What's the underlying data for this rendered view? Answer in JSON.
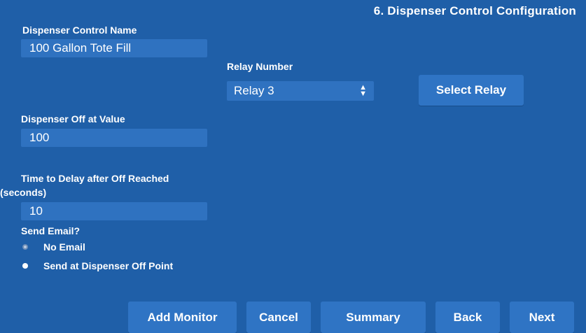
{
  "header": {
    "title": "6. Dispenser Control Configuration"
  },
  "form": {
    "name_label": "Dispenser Control Name",
    "name_value": "100 Gallon Tote Fill",
    "relay_label": "Relay Number",
    "relay_value": "Relay 3",
    "select_relay_button": "Select Relay",
    "off_value_label": "Dispenser Off at Value",
    "off_value": "100",
    "delay_label_line1": "Time to Delay after Off Reached",
    "delay_label_line2": "(seconds)",
    "delay_value": "10",
    "email_label": "Send Email?",
    "email_options": [
      {
        "label": "No Email",
        "selected": false
      },
      {
        "label": "Send at Dispenser Off Point",
        "selected": true
      }
    ]
  },
  "footer": {
    "add_monitor": "Add Monitor",
    "cancel": "Cancel",
    "summary": "Summary",
    "back": "Back",
    "next": "Next"
  },
  "colors": {
    "background": "#1f5fa8",
    "field": "#2f72c0",
    "button": "#2f74c4",
    "text": "#ffffff"
  }
}
